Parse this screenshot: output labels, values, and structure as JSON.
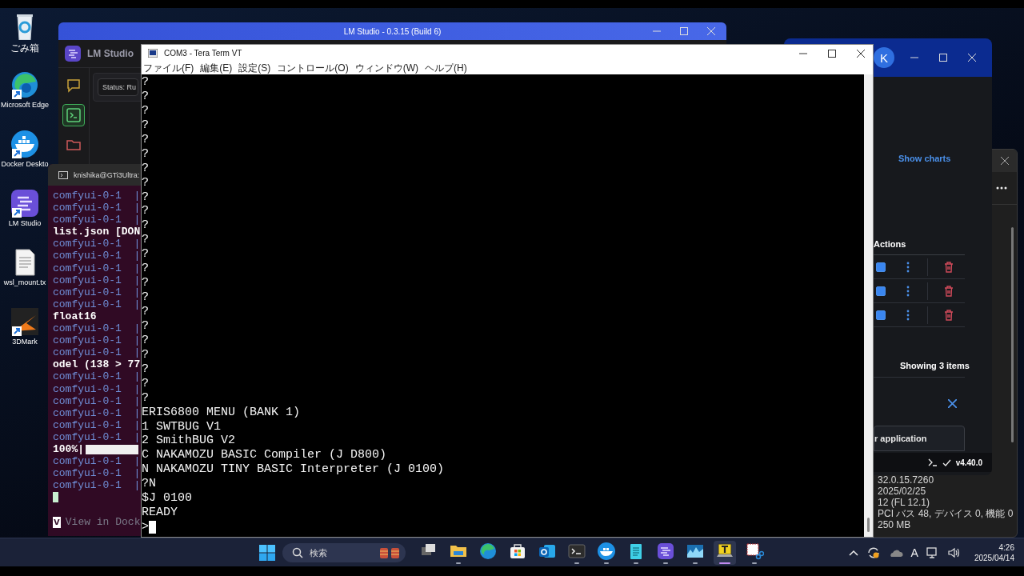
{
  "desktop_icons": [
    {
      "kind": "recycle",
      "label": "ごみ箱"
    },
    {
      "kind": "edge",
      "label": "Microsoft Edge"
    },
    {
      "kind": "docker",
      "label": "Docker Deskto"
    },
    {
      "kind": "lmstudio",
      "label": "LM Studio"
    },
    {
      "kind": "textfile",
      "label": "wsl_mount.tx"
    },
    {
      "kind": "benchmark",
      "label": "3DMark"
    }
  ],
  "lm_studio": {
    "title": "LM Studio - 0.3.15 (Build 6)",
    "app_name": "LM Studio",
    "status_button": "Status: Ru",
    "sidebar": [
      {
        "kind": "chat",
        "selected": false
      },
      {
        "kind": "terminal",
        "selected": true
      },
      {
        "kind": "folder",
        "selected": false
      }
    ]
  },
  "wsl_terminal": {
    "title": "knishika@GTi3Ultra:",
    "lines": [
      {
        "kind": "log",
        "text": "comfyui-0-1  |"
      },
      {
        "kind": "log",
        "text": "comfyui-0-1  |"
      },
      {
        "kind": "log",
        "text": "comfyui-0-1  |"
      },
      {
        "kind": "plain",
        "text": "list.json [DON"
      },
      {
        "kind": "log",
        "text": "comfyui-0-1  |"
      },
      {
        "kind": "log",
        "text": "comfyui-0-1  |"
      },
      {
        "kind": "log",
        "text": "comfyui-0-1  |"
      },
      {
        "kind": "log",
        "text": "comfyui-0-1  |"
      },
      {
        "kind": "log",
        "text": "comfyui-0-1  |"
      },
      {
        "kind": "log",
        "text": "comfyui-0-1  |"
      },
      {
        "kind": "plain",
        "text": "float16"
      },
      {
        "kind": "log",
        "text": "comfyui-0-1  |"
      },
      {
        "kind": "log",
        "text": "comfyui-0-1  |"
      },
      {
        "kind": "log",
        "text": "comfyui-0-1  |"
      },
      {
        "kind": "plain",
        "text": "odel (138 > 77"
      },
      {
        "kind": "log",
        "text": "comfyui-0-1  |"
      },
      {
        "kind": "log",
        "text": "comfyui-0-1  |"
      },
      {
        "kind": "log",
        "text": "comfyui-0-1  |"
      },
      {
        "kind": "log",
        "text": "comfyui-0-1  |"
      },
      {
        "kind": "log",
        "text": "comfyui-0-1  |"
      },
      {
        "kind": "log",
        "text": "comfyui-0-1  |"
      },
      {
        "kind": "progress",
        "text": "100%|",
        "level": 1
      },
      {
        "kind": "log",
        "text": "comfyui-0-1  |"
      },
      {
        "kind": "log",
        "text": "comfyui-0-1  |"
      },
      {
        "kind": "log",
        "text": "comfyui-0-1  |"
      }
    ],
    "hint_key": "v",
    "hint_text": "View in Dock"
  },
  "tera_term": {
    "title": "COM3 - Tera Term VT",
    "menu": [
      "ファイル(F)",
      "編集(E)",
      "設定(S)",
      "コントロール(O)",
      "ウィンドウ(W)",
      "ヘルプ(H)"
    ],
    "lines": [
      "?",
      "?",
      "?",
      "?",
      "?",
      "?",
      "?",
      "?",
      "?",
      "?",
      "?",
      "?",
      "?",
      "?",
      "?",
      "?",
      "?",
      "?",
      "?",
      "?",
      "?",
      "?",
      "?",
      "ERIS6800 MENU (BANK 1)",
      "1 SWTBUG V1",
      "2 SmithBUG V2",
      "C NAKAMOZU BASIC Compiler (J D800)",
      "N NAKAMOZU TINY BASIC Interpreter (J 0100)",
      "?N",
      "$J 0100",
      "READY",
      ">"
    ]
  },
  "docker": {
    "avatar": "K",
    "show_charts": "Show charts",
    "actions_header": "Actions",
    "rows": [
      {
        "checked": true
      },
      {
        "checked": true
      },
      {
        "checked": true
      }
    ],
    "footer_count": "Showing 3 items",
    "button": "r application",
    "version": "v4.40.0"
  },
  "device_properties": {
    "values": [
      "32.0.15.7260",
      "2025/02/25",
      "12 (FL 12.1)",
      "PCI バス 48, デバイス 0, 機能 0",
      "250 MB"
    ]
  },
  "taskbar": {
    "search_placeholder": "検索",
    "apps": [
      {
        "kind": "taskview",
        "running": false,
        "active": false
      },
      {
        "kind": "explorer",
        "running": true,
        "active": false
      },
      {
        "kind": "edge",
        "running": false,
        "active": false
      },
      {
        "kind": "store",
        "running": false,
        "active": false
      },
      {
        "kind": "outlook",
        "running": false,
        "active": false
      },
      {
        "kind": "terminal",
        "running": true,
        "active": false
      },
      {
        "kind": "docker",
        "running": true,
        "active": false
      },
      {
        "kind": "notepad",
        "running": true,
        "active": false
      },
      {
        "kind": "lmstudio",
        "running": true,
        "active": false
      },
      {
        "kind": "monitor",
        "running": true,
        "active": false
      },
      {
        "kind": "teraterm",
        "running": true,
        "active": true
      },
      {
        "kind": "snip",
        "running": true,
        "active": false
      }
    ],
    "ime": "A",
    "time": "4:26",
    "date": "2025/04/14"
  }
}
